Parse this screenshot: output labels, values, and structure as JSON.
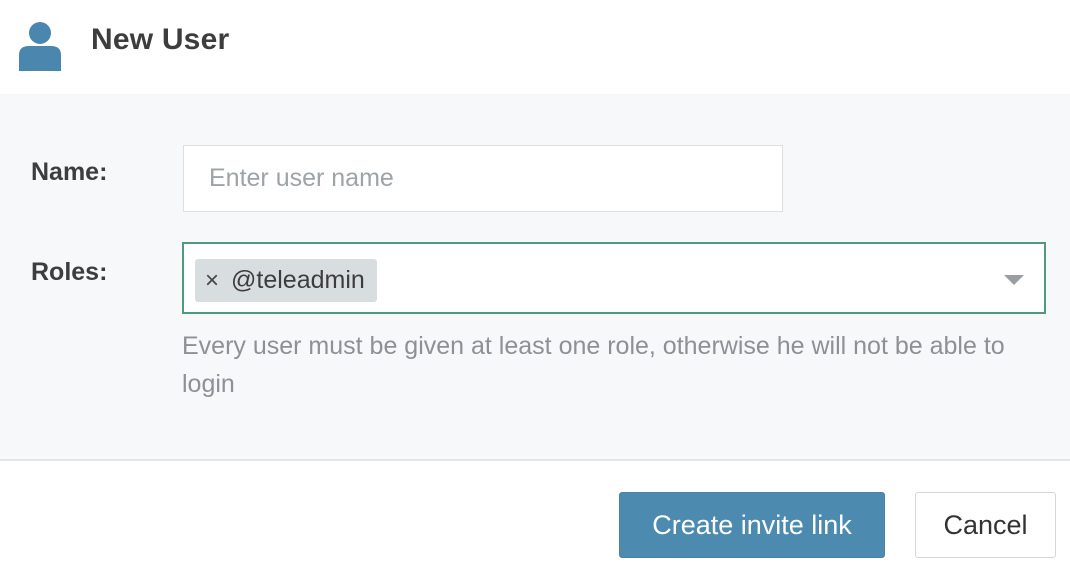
{
  "header": {
    "title": "New User",
    "icon": "user-icon"
  },
  "form": {
    "name_label": "Name:",
    "name_value": "",
    "name_placeholder": "Enter user name",
    "roles_label": "Roles:",
    "roles": [
      {
        "remove_glyph": "×",
        "label": "@teleadmin"
      }
    ],
    "roles_help": "Every user must be given at least one role, otherwise he will not be able to login"
  },
  "footer": {
    "primary_label": "Create invite link",
    "cancel_label": "Cancel"
  },
  "colors": {
    "primary": "#4c8ab0",
    "focus_border": "#4f9a7c",
    "icon": "#4a86ad"
  }
}
